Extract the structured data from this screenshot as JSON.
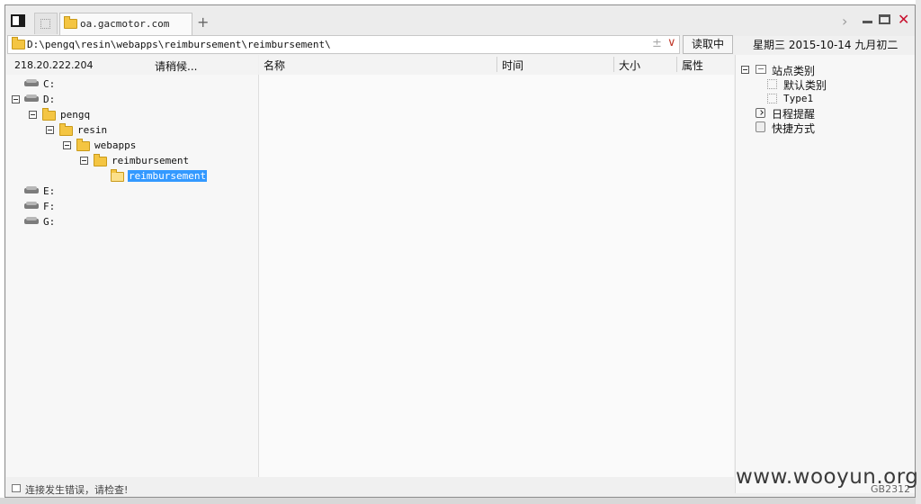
{
  "tab": {
    "title": "oa.gacmotor.com"
  },
  "address": {
    "path": "D:\\pengq\\resin\\webapps\\reimbursement\\reimbursement\\",
    "read_label": "读取中"
  },
  "date": {
    "text": "星期三  2015-10-14  九月初二"
  },
  "connection": {
    "ip": "218.20.222.204",
    "waiting": "请稍候..."
  },
  "columns": [
    "名称",
    "时间",
    "大小",
    "属性"
  ],
  "tree": [
    {
      "label": "C:",
      "type": "drive"
    },
    {
      "label": "D:",
      "type": "drive"
    },
    {
      "label": "pengq",
      "type": "folder"
    },
    {
      "label": "resin",
      "type": "folder"
    },
    {
      "label": "webapps",
      "type": "folder"
    },
    {
      "label": "reimbursement",
      "type": "folder"
    },
    {
      "label": "reimbursement",
      "type": "folder",
      "selected": true
    },
    {
      "label": "E:",
      "type": "drive"
    },
    {
      "label": "F:",
      "type": "drive"
    },
    {
      "label": "G:",
      "type": "drive"
    }
  ],
  "sites": {
    "root": "站点类别",
    "children": [
      "默认类别",
      "Type1"
    ],
    "reminder": "日程提醒",
    "shortcut": "快捷方式"
  },
  "status": {
    "text": "连接发生错误，请检查!",
    "encoding": "GB2312"
  },
  "watermark": "www.wooyun.org",
  "colors": {
    "selection": "#3399ff",
    "close": "#c8102e",
    "folder": "#f4c542"
  }
}
